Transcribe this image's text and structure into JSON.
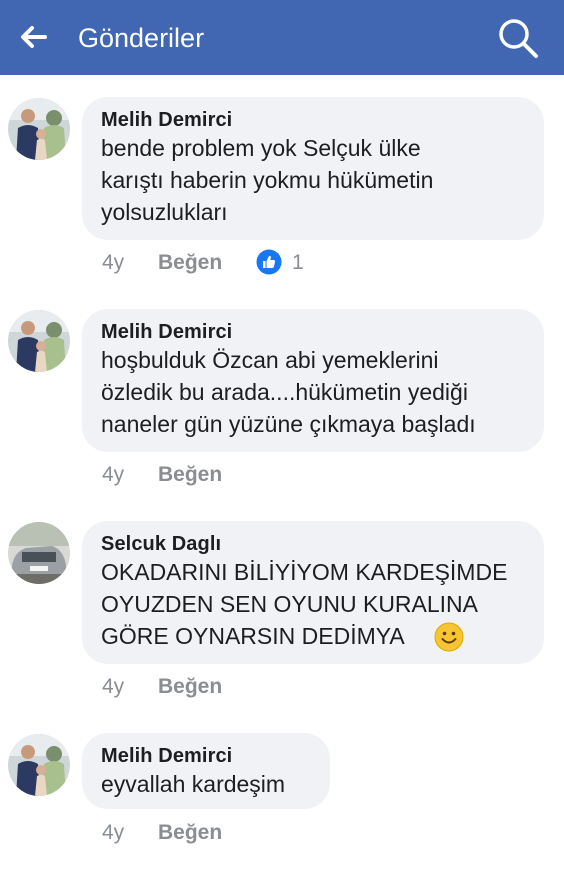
{
  "header": {
    "title": "Gönderiler",
    "back_icon": "arrow-left-icon",
    "search_icon": "search-icon",
    "background": "#4267b2"
  },
  "comments": [
    {
      "author": "Melih Demirci",
      "text": "bende problem yok Selçuk ülke\nkarıştı haberin yokmu hükümetin\nyolsuzlukları",
      "time": "4y",
      "like_label": "Beğen",
      "reaction_icon": "thumbs-up-icon",
      "reaction_count": "1"
    },
    {
      "author": "Melih Demirci",
      "text": "hoşbulduk Özcan abi yemeklerini\nözledik bu arada....hükümetin yediği\nnaneler gün yüzüne çıkmaya başladı",
      "time": "4y",
      "like_label": "Beğen"
    },
    {
      "author": "Selcuk Daglı",
      "text": "OKADARINI BİLİYİYOM KARDEŞİMDE\nOYUZDEN SEN OYUNU KURALINA\nGÖRE OYNARSIN DEDİMYA",
      "emoji_icon": "smiley-icon",
      "time": "4y",
      "like_label": "Beğen"
    },
    {
      "author": "Melih Demirci",
      "text": "eyvallah kardeşim",
      "time": "4y",
      "like_label": "Beğen"
    }
  ],
  "colors": {
    "bubble": "#f0f2f5",
    "meta_text": "#8a8d91",
    "reaction_blue": "#1877f2"
  }
}
